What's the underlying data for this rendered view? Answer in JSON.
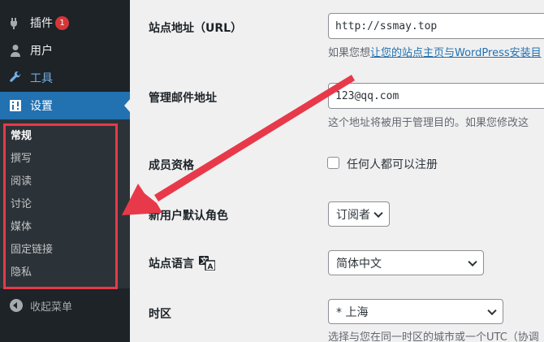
{
  "sidebar": {
    "items": [
      {
        "label": "插件",
        "badge": "1",
        "icon": "plugins-icon"
      },
      {
        "label": "用户",
        "icon": "users-icon"
      },
      {
        "label": "工具",
        "icon": "tools-icon"
      },
      {
        "label": "设置",
        "icon": "settings-icon"
      }
    ],
    "submenu": [
      "常规",
      "撰写",
      "阅读",
      "讨论",
      "媒体",
      "固定链接",
      "隐私"
    ],
    "collapse_label": "收起菜单"
  },
  "form": {
    "site_url": {
      "label": "站点地址（URL）",
      "value": "http://ssmay.top",
      "desc_prefix": "如果您想",
      "desc_link": "让您的站点主页与WordPress安装目"
    },
    "admin_email": {
      "label": "管理邮件地址",
      "value": "123@qq.com",
      "desc": "这个地址将被用于管理目的。如果您修改这"
    },
    "membership": {
      "label": "成员资格",
      "checkbox_label": "任何人都可以注册",
      "checked": false
    },
    "default_role": {
      "label": "新用户默认角色",
      "value": "订阅者"
    },
    "site_language": {
      "label": "站点语言",
      "value": "简体中文",
      "icon": "translate-icon"
    },
    "timezone": {
      "label": "时区",
      "value": "* 上海",
      "desc": "选择与您在同一时区的城市或一个UTC（协调"
    }
  },
  "colors": {
    "annotation_red": "#e8394a",
    "sidebar_bg": "#1d2327",
    "active_blue": "#2271b1"
  }
}
